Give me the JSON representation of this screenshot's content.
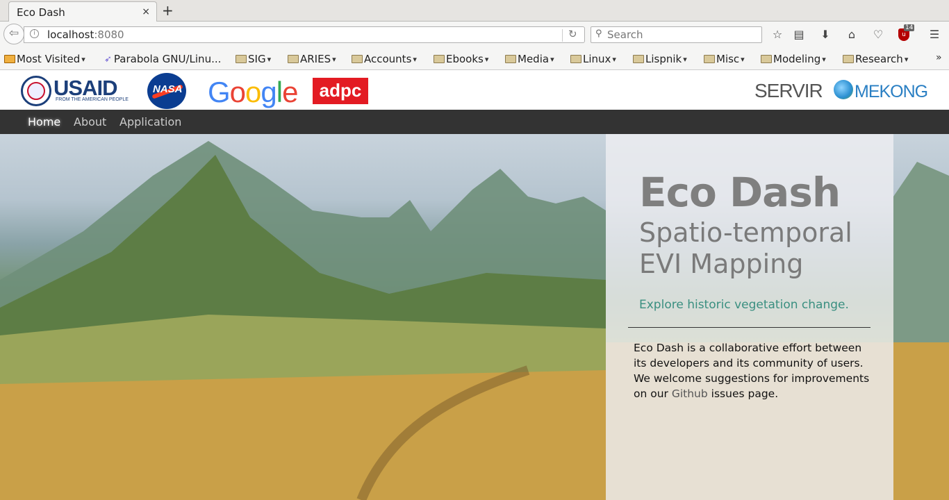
{
  "browser": {
    "tab_title": "Eco Dash",
    "tab_close": "×",
    "new_tab": "+",
    "url_host": "localhost",
    "url_port": ":8080",
    "search_placeholder": "Search",
    "ublock_count": "14"
  },
  "bookmarks": [
    {
      "label": "Most Visited",
      "folder": false,
      "chevron": true
    },
    {
      "label": "Parabola GNU/Linu...",
      "folder": false,
      "chevron": false
    },
    {
      "label": "SIG",
      "folder": true,
      "chevron": true
    },
    {
      "label": "ARIES",
      "folder": true,
      "chevron": true
    },
    {
      "label": "Accounts",
      "folder": true,
      "chevron": true
    },
    {
      "label": "Ebooks",
      "folder": true,
      "chevron": true
    },
    {
      "label": "Media",
      "folder": true,
      "chevron": true
    },
    {
      "label": "Linux",
      "folder": true,
      "chevron": true
    },
    {
      "label": "Lispnik",
      "folder": true,
      "chevron": true
    },
    {
      "label": "Misc",
      "folder": true,
      "chevron": true
    },
    {
      "label": "Modeling",
      "folder": true,
      "chevron": true
    },
    {
      "label": "Research",
      "folder": true,
      "chevron": true
    }
  ],
  "logos": {
    "usaid": "USAID",
    "usaid_sub": "FROM THE AMERICAN PEOPLE",
    "nasa": "NASA",
    "google": [
      "G",
      "o",
      "o",
      "g",
      "l",
      "e"
    ],
    "google_colors": [
      "#4285f4",
      "#ea4335",
      "#fbbc05",
      "#4285f4",
      "#34a853",
      "#ea4335"
    ],
    "adpc": "adpc",
    "servir": "SERVIR",
    "mekong": "MEKONG"
  },
  "nav": {
    "home": "Home",
    "about": "About",
    "application": "Application"
  },
  "hero": {
    "title": "Eco Dash",
    "subtitle": "Spatio-temporal EVI Mapping",
    "tagline": "Explore historic vegetation change.",
    "desc_before": "Eco Dash is a collaborative effort between its developers and its community of users. We welcome suggestions for improvements on our ",
    "desc_link": "Github",
    "desc_after": " issues page."
  }
}
